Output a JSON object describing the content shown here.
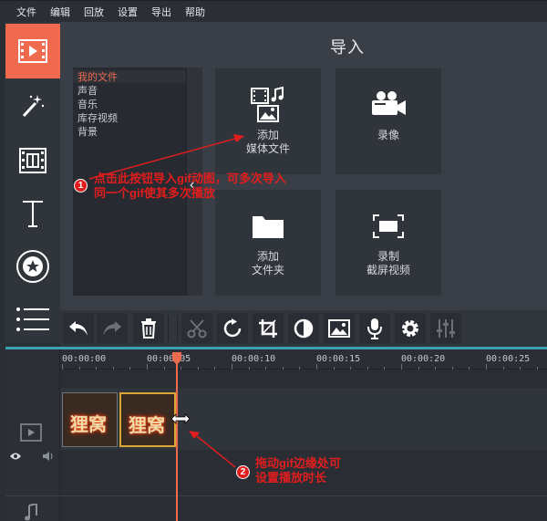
{
  "menu": {
    "items": [
      "文件",
      "编辑",
      "回放",
      "设置",
      "导出",
      "帮助"
    ]
  },
  "rail": {
    "buttons": [
      {
        "icon": "media-import-icon",
        "active": true
      },
      {
        "icon": "magic-wand-icon",
        "active": false
      },
      {
        "icon": "transitions-icon",
        "active": false
      },
      {
        "icon": "text-icon",
        "active": false
      },
      {
        "icon": "stickers-icon",
        "active": false
      },
      {
        "icon": "more-list-icon",
        "active": false
      }
    ]
  },
  "import_panel": {
    "title": "导入",
    "file_list": [
      "我的文件",
      "声音",
      "音乐",
      "库存视频",
      "背景"
    ],
    "tiles": [
      {
        "label": "添加\n媒体文件",
        "icon": "media-files-icon"
      },
      {
        "label": "录像",
        "icon": "video-camera-icon"
      },
      {
        "label": "添加\n文件夹",
        "icon": "folder-icon"
      },
      {
        "label": "录制\n截屏视频",
        "icon": "screen-capture-icon"
      }
    ]
  },
  "toolbar": {
    "buttons": [
      "undo-icon",
      "redo-icon",
      "delete-icon",
      "cut-icon",
      "rotate-icon",
      "crop-icon",
      "color-adjust-icon",
      "image-icon",
      "microphone-icon",
      "settings-icon",
      "equalizer-icon"
    ]
  },
  "timeline": {
    "ruler_labels": [
      "00:00:00",
      "00:00:05",
      "00:00:10",
      "00:00:15",
      "00:00:20",
      "00:00:25"
    ],
    "clip_thumb_text": "狸窝"
  },
  "annotations": {
    "note1_badge": "1",
    "note1_line1": "点击此按钮导入gif动图，可多次导入",
    "note1_line2": "同一个gif使其多次播放",
    "note2_badge": "2",
    "note2_line1": "拖动gif边缘处可",
    "note2_line2": "设置播放时长"
  },
  "colors": {
    "accent": "#ef6a4f",
    "annotation": "#e21d1d",
    "timeline_border": "#3ca0b4",
    "selected_clip": "#d9a534"
  }
}
